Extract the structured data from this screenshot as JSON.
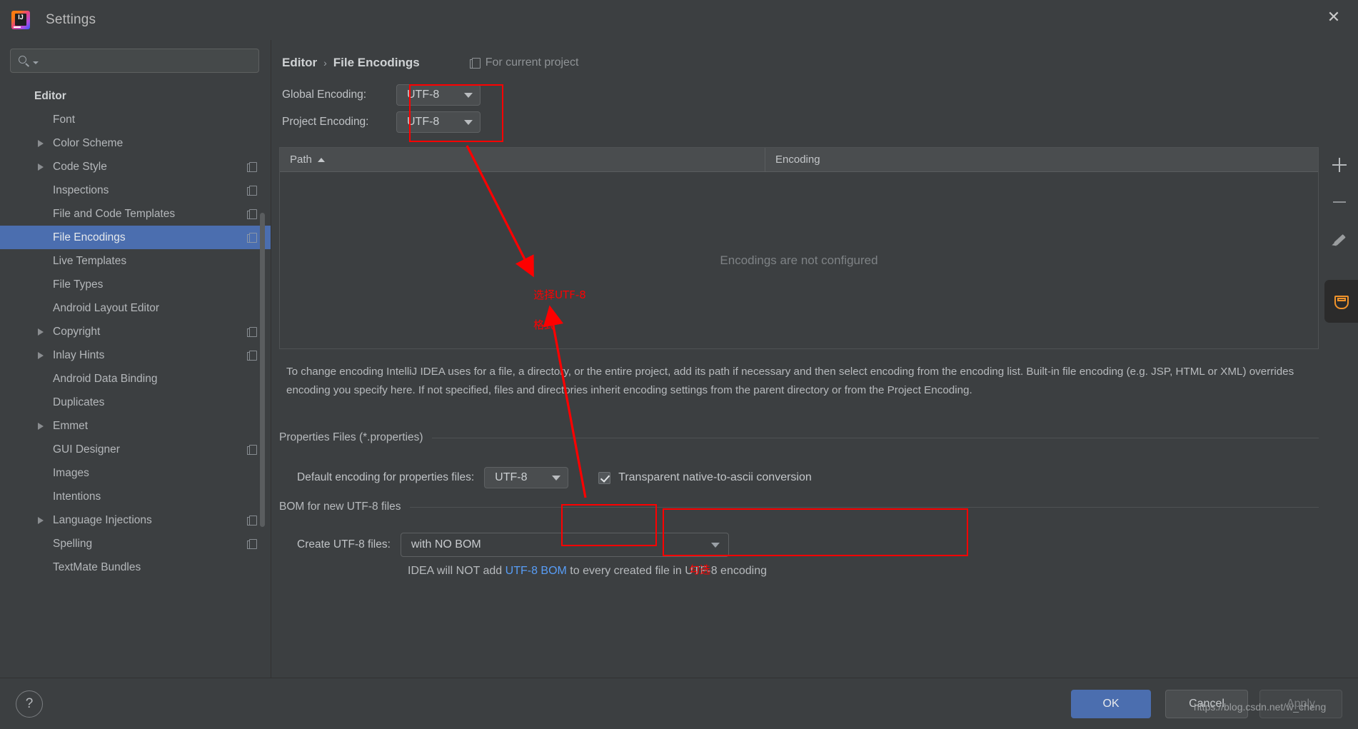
{
  "window": {
    "title": "Settings",
    "logo_text": "IJ",
    "close_label": "✕"
  },
  "search": {
    "value": "",
    "placeholder": ""
  },
  "sidebar": {
    "items": [
      {
        "label": "Editor",
        "indent": 0,
        "arrow": false,
        "group": true,
        "selected": false,
        "cfg": false
      },
      {
        "label": "Font",
        "indent": 1,
        "arrow": false,
        "group": false,
        "selected": false,
        "cfg": false
      },
      {
        "label": "Color Scheme",
        "indent": 1,
        "arrow": true,
        "group": false,
        "selected": false,
        "cfg": false
      },
      {
        "label": "Code Style",
        "indent": 1,
        "arrow": true,
        "group": false,
        "selected": false,
        "cfg": true
      },
      {
        "label": "Inspections",
        "indent": 1,
        "arrow": false,
        "group": false,
        "selected": false,
        "cfg": true
      },
      {
        "label": "File and Code Templates",
        "indent": 1,
        "arrow": false,
        "group": false,
        "selected": false,
        "cfg": true
      },
      {
        "label": "File Encodings",
        "indent": 1,
        "arrow": false,
        "group": false,
        "selected": true,
        "cfg": true
      },
      {
        "label": "Live Templates",
        "indent": 1,
        "arrow": false,
        "group": false,
        "selected": false,
        "cfg": false
      },
      {
        "label": "File Types",
        "indent": 1,
        "arrow": false,
        "group": false,
        "selected": false,
        "cfg": false
      },
      {
        "label": "Android Layout Editor",
        "indent": 1,
        "arrow": false,
        "group": false,
        "selected": false,
        "cfg": false
      },
      {
        "label": "Copyright",
        "indent": 1,
        "arrow": true,
        "group": false,
        "selected": false,
        "cfg": true
      },
      {
        "label": "Inlay Hints",
        "indent": 1,
        "arrow": true,
        "group": false,
        "selected": false,
        "cfg": true
      },
      {
        "label": "Android Data Binding",
        "indent": 1,
        "arrow": false,
        "group": false,
        "selected": false,
        "cfg": false
      },
      {
        "label": "Duplicates",
        "indent": 1,
        "arrow": false,
        "group": false,
        "selected": false,
        "cfg": false
      },
      {
        "label": "Emmet",
        "indent": 1,
        "arrow": true,
        "group": false,
        "selected": false,
        "cfg": false
      },
      {
        "label": "GUI Designer",
        "indent": 1,
        "arrow": false,
        "group": false,
        "selected": false,
        "cfg": true
      },
      {
        "label": "Images",
        "indent": 1,
        "arrow": false,
        "group": false,
        "selected": false,
        "cfg": false
      },
      {
        "label": "Intentions",
        "indent": 1,
        "arrow": false,
        "group": false,
        "selected": false,
        "cfg": false
      },
      {
        "label": "Language Injections",
        "indent": 1,
        "arrow": true,
        "group": false,
        "selected": false,
        "cfg": true
      },
      {
        "label": "Spelling",
        "indent": 1,
        "arrow": false,
        "group": false,
        "selected": false,
        "cfg": true
      },
      {
        "label": "TextMate Bundles",
        "indent": 1,
        "arrow": false,
        "group": false,
        "selected": false,
        "cfg": false
      }
    ]
  },
  "main": {
    "breadcrumb": {
      "parent": "Editor",
      "separator": "›",
      "current": "File Encodings"
    },
    "for_current_project": "For current project",
    "global_encoding": {
      "label": "Global Encoding:",
      "value": "UTF-8"
    },
    "project_encoding": {
      "label": "Project Encoding:",
      "value": "UTF-8"
    },
    "table": {
      "columns": [
        "Path",
        "Encoding"
      ],
      "sort_indicator": "▲",
      "empty_text": "Encodings are not configured",
      "rows": []
    },
    "toolbar": {
      "add": "+",
      "remove": "−",
      "edit": "edit"
    },
    "description": "To change encoding IntelliJ IDEA uses for a file, a directory, or the entire project, add its path if necessary and then select encoding from the encoding list. Built-in file encoding (e.g. JSP, HTML or XML) overrides encoding you specify here. If not specified, files and directories inherit encoding settings from the parent directory or from the Project Encoding.",
    "properties_section": {
      "title": "Properties Files (*.properties)",
      "default_encoding_label": "Default encoding for properties files:",
      "default_encoding_value": "UTF-8",
      "checkbox_label": "Transparent native-to-ascii conversion",
      "checkbox_checked": true
    },
    "bom_section": {
      "title": "BOM for new UTF-8 files",
      "create_label": "Create UTF-8 files:",
      "create_value": "with NO BOM",
      "note_prefix": "IDEA will NOT add ",
      "note_link": "UTF-8 BOM",
      "note_suffix": " to every created file in UTF-8 encoding"
    }
  },
  "annotations": {
    "color": "#fe0000",
    "note_1_line_1": "选择UTF-8",
    "note_1_line_2": "格式",
    "note_2": "勾选"
  },
  "footer": {
    "help": "?",
    "ok": "OK",
    "cancel": "Cancel",
    "apply": "Apply"
  },
  "watermark": "https://blog.csdn.net/w_cheng"
}
